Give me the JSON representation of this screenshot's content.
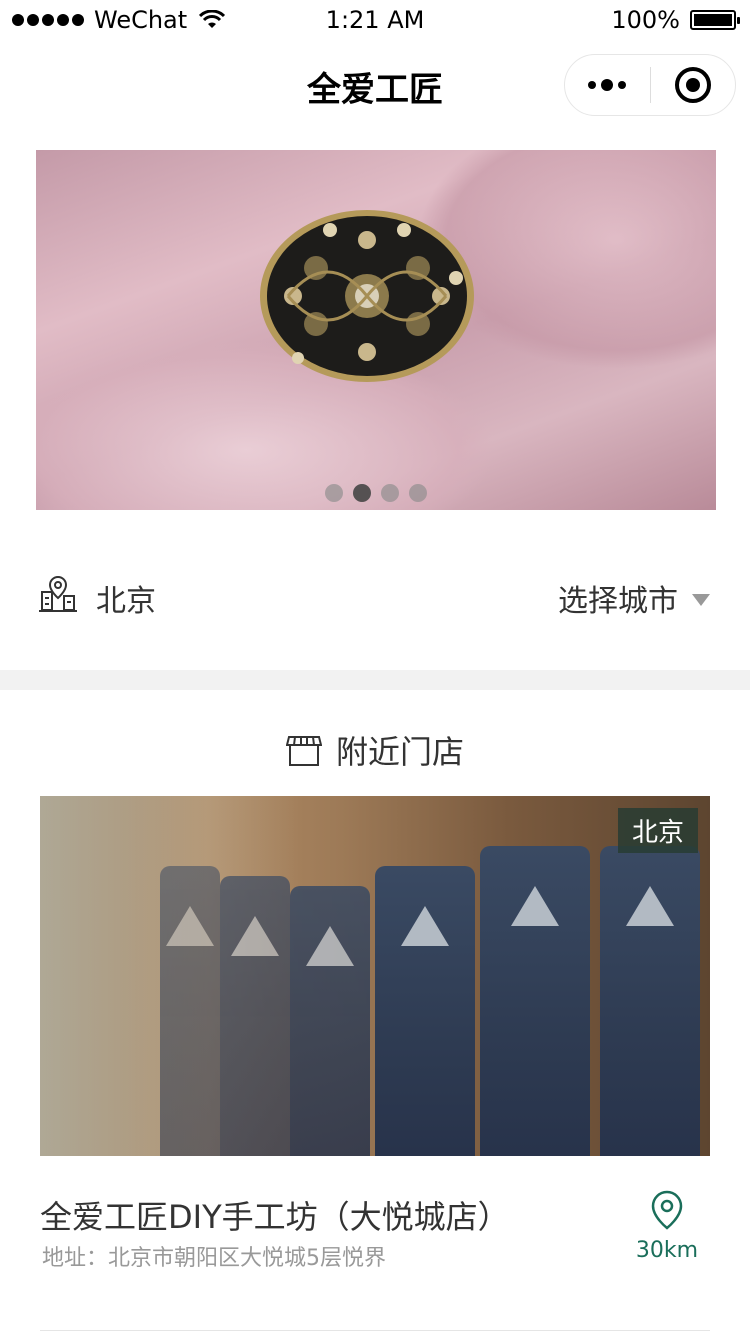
{
  "status_bar": {
    "carrier": "WeChat",
    "time": "1:21 AM",
    "battery": "100%"
  },
  "nav": {
    "title": "全爱工匠"
  },
  "banner": {
    "slide_count": 4,
    "active_index": 1
  },
  "location": {
    "city": "北京",
    "select_label": "选择城市"
  },
  "nearby": {
    "title": "附近门店"
  },
  "store": {
    "badge": "北京",
    "name": "全爱工匠DIY手工坊（大悦城店）",
    "address": "地址：北京市朝阳区大悦城5层悦界",
    "distance": "30km"
  },
  "colors": {
    "accent": "#1a6e5a",
    "text_primary": "#333333",
    "text_secondary": "#999999",
    "separator": "#f2f2f2"
  },
  "icons": {
    "signal": "signal-dots-icon",
    "wifi": "wifi-icon",
    "battery": "battery-icon",
    "more": "more-dots-icon",
    "close": "target-circle-icon",
    "city": "city-location-icon",
    "dropdown": "triangle-down-icon",
    "store": "storefront-icon",
    "pin": "map-pin-icon"
  }
}
